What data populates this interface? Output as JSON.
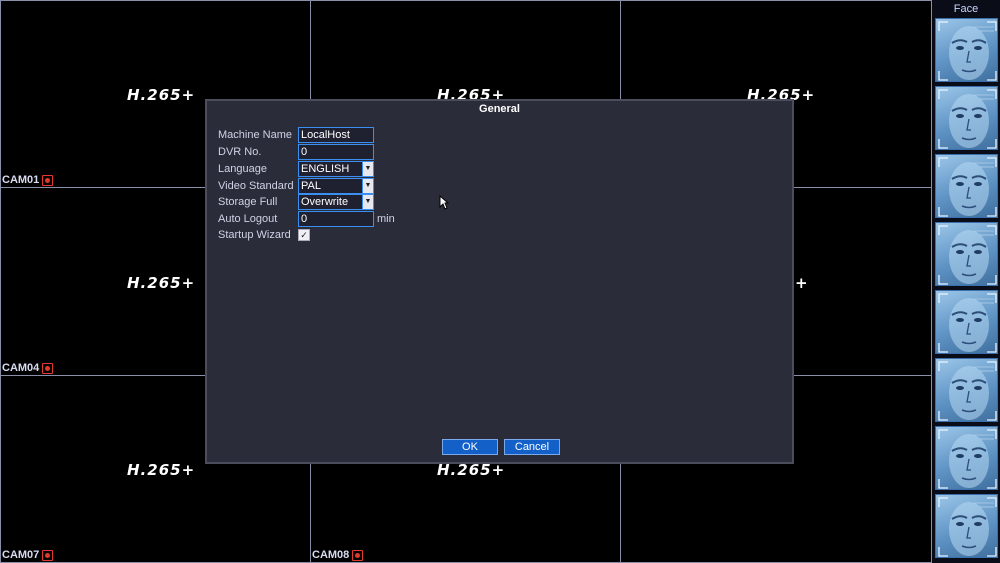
{
  "grid": {
    "codec_label": "H.265+",
    "cells": [
      {
        "cam": "CAM01"
      },
      {
        "cam": ""
      },
      {
        "cam": ""
      },
      {
        "cam": "CAM04"
      },
      {
        "cam": ""
      },
      {
        "cam": ""
      },
      {
        "cam": "CAM07"
      },
      {
        "cam": "CAM08"
      },
      {
        "cam": ""
      }
    ],
    "partial_codec_suffix": "+"
  },
  "sidebar": {
    "title": "Face",
    "thumbnail_count": 8
  },
  "dialog": {
    "title": "General",
    "fields": {
      "machine_name": {
        "label": "Machine Name",
        "value": "LocalHost"
      },
      "dvr_no": {
        "label": "DVR No.",
        "value": "0"
      },
      "language": {
        "label": "Language",
        "value": "ENGLISH"
      },
      "video_standard": {
        "label": "Video Standard",
        "value": "PAL"
      },
      "storage_full": {
        "label": "Storage Full",
        "value": "Overwrite"
      },
      "auto_logout": {
        "label": "Auto Logout",
        "value": "0",
        "unit": "min"
      },
      "startup_wizard": {
        "label": "Startup Wizard",
        "checked": true
      }
    },
    "ok_label": "OK",
    "cancel_label": "Cancel"
  },
  "icons": {
    "record": "record-icon",
    "dropdown": "chevron-down-icon",
    "check": "checkmark-icon",
    "cursor": "mouse-pointer-icon"
  },
  "colors": {
    "grid_line": "#8a8fa8",
    "dialog_bg": "#2b2c3a",
    "accent": "#3a8ff0",
    "button": "#1260c8",
    "record_red": "#e03a2a"
  }
}
